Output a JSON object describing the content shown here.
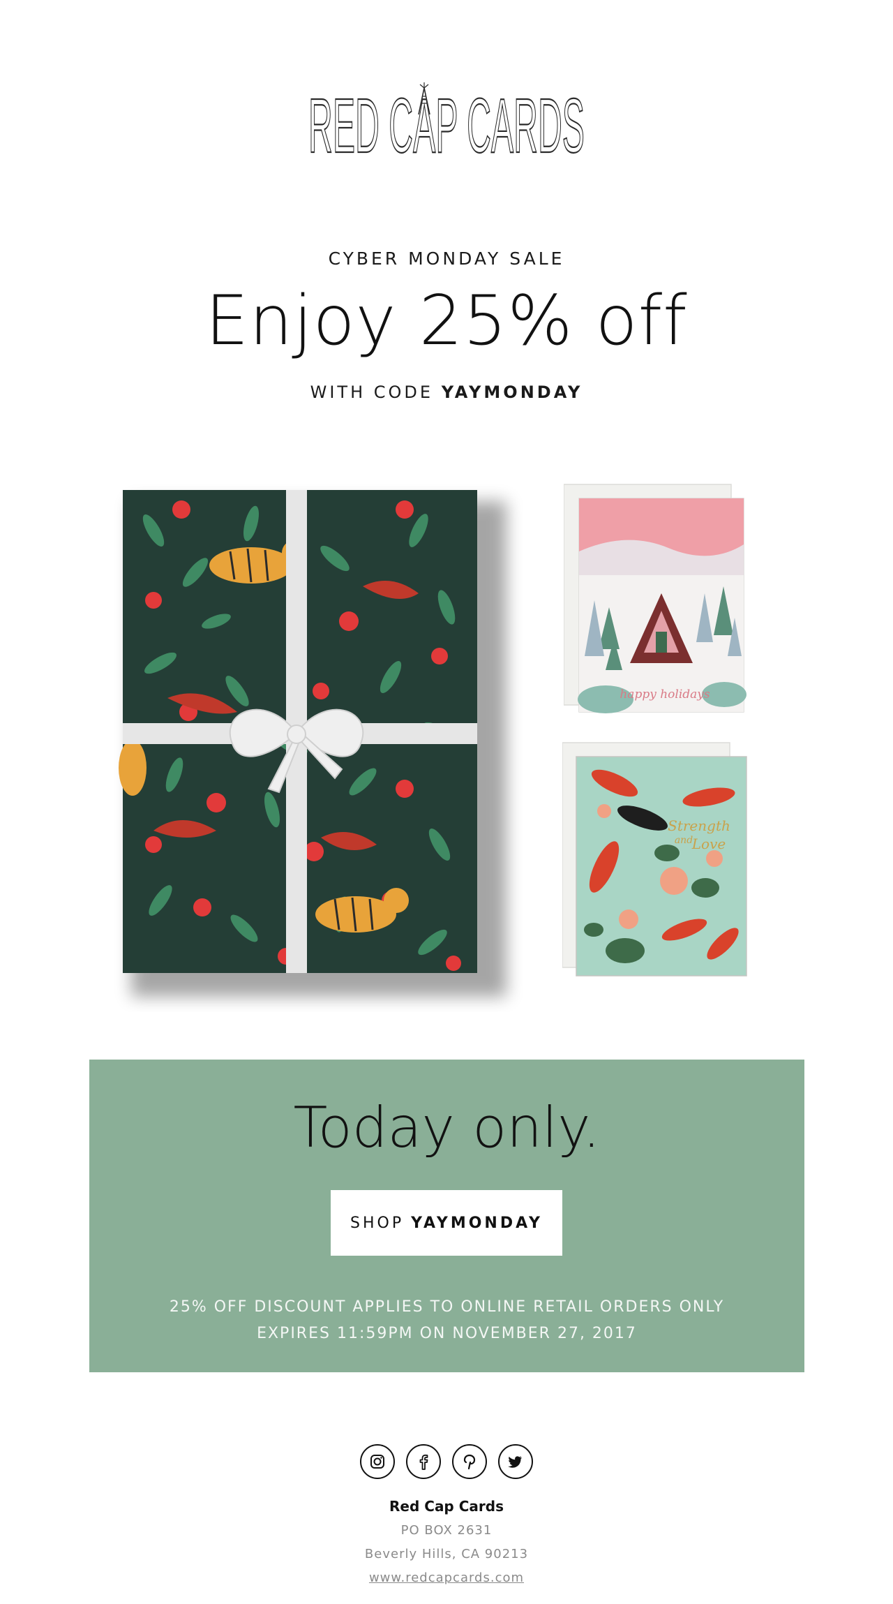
{
  "brand": {
    "logo_text": "RED CAP CARDS"
  },
  "hero": {
    "eyebrow": "CYBER MONDAY SALE",
    "headline": "Enjoy 25% off",
    "code_prefix": "WITH CODE",
    "code": "YAYMONDAY"
  },
  "products": {
    "card1_script": "happy holidays",
    "card2_script_line1": "Strength",
    "card2_script_line2": "and",
    "card2_script_line3": "Love"
  },
  "banner": {
    "title": "Today only.",
    "button_prefix": "SHOP",
    "button_code": "YAYMONDAY",
    "fine_line1": "25% OFF DISCOUNT APPLIES TO ONLINE RETAIL ORDERS ONLY",
    "fine_line2": "EXPIRES 11:59PM ON NOVEMBER 27, 2017",
    "background_color": "#8aaf97"
  },
  "footer": {
    "socials": [
      "instagram-icon",
      "facebook-icon",
      "pinterest-icon",
      "twitter-icon"
    ],
    "company": "Red Cap Cards",
    "po_box": "PO BOX 2631",
    "city": "Beverly Hills, CA 90213",
    "website": "www.redcapcards.com"
  }
}
